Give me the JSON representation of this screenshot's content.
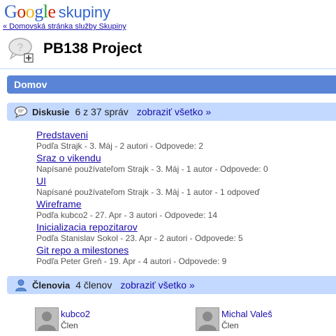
{
  "header": {
    "logo_google": [
      "G",
      "o",
      "o",
      "g",
      "l",
      "e"
    ],
    "logo_product": "skupiny",
    "home_link": "« Domovská stránka služby Skupiny"
  },
  "group": {
    "title": "PB138 Project"
  },
  "home_bar": {
    "label": "Domov"
  },
  "discussions": {
    "title": "Diskusie",
    "count": "6 z 37 správ",
    "see_all": "zobraziť všetko »",
    "topics": [
      {
        "title": "Predstaveni",
        "meta": "Podľa Strajk - 3. Máj - 2 autori - Odpovede: 2"
      },
      {
        "title": "Sraz o vikendu",
        "meta": "Napísané používateľom Strajk - 3. Máj - 1 autor - Odpovede: 0"
      },
      {
        "title": "UI",
        "meta": "Napísané používateľom Strajk - 3. Máj - 1 autor - 1 odpoveď"
      },
      {
        "title": "Wireframe",
        "meta": "Podľa kubco2 - 27. Apr - 3 autori - Odpovede: 14"
      },
      {
        "title": "Inicializacia repozitarov",
        "meta": "Podľa Stanislav Sokol - 23. Apr - 2 autori - Odpovede: 5"
      },
      {
        "title": "Git repo a milestones",
        "meta": "Podľa Peter Greň - 19. Apr - 4 autori - Odpovede: 9"
      }
    ]
  },
  "members": {
    "title": "Členovia",
    "count": "4 členov",
    "see_all": "zobraziť všetko »",
    "list": [
      {
        "name": "kubco2",
        "role": "Člen"
      },
      {
        "name": "Michal Valeš",
        "role": "Člen"
      }
    ]
  },
  "colors": {
    "link": "#1a0dab",
    "home_bar": "#5a84d6",
    "section_bar": "#c3d9ff"
  }
}
